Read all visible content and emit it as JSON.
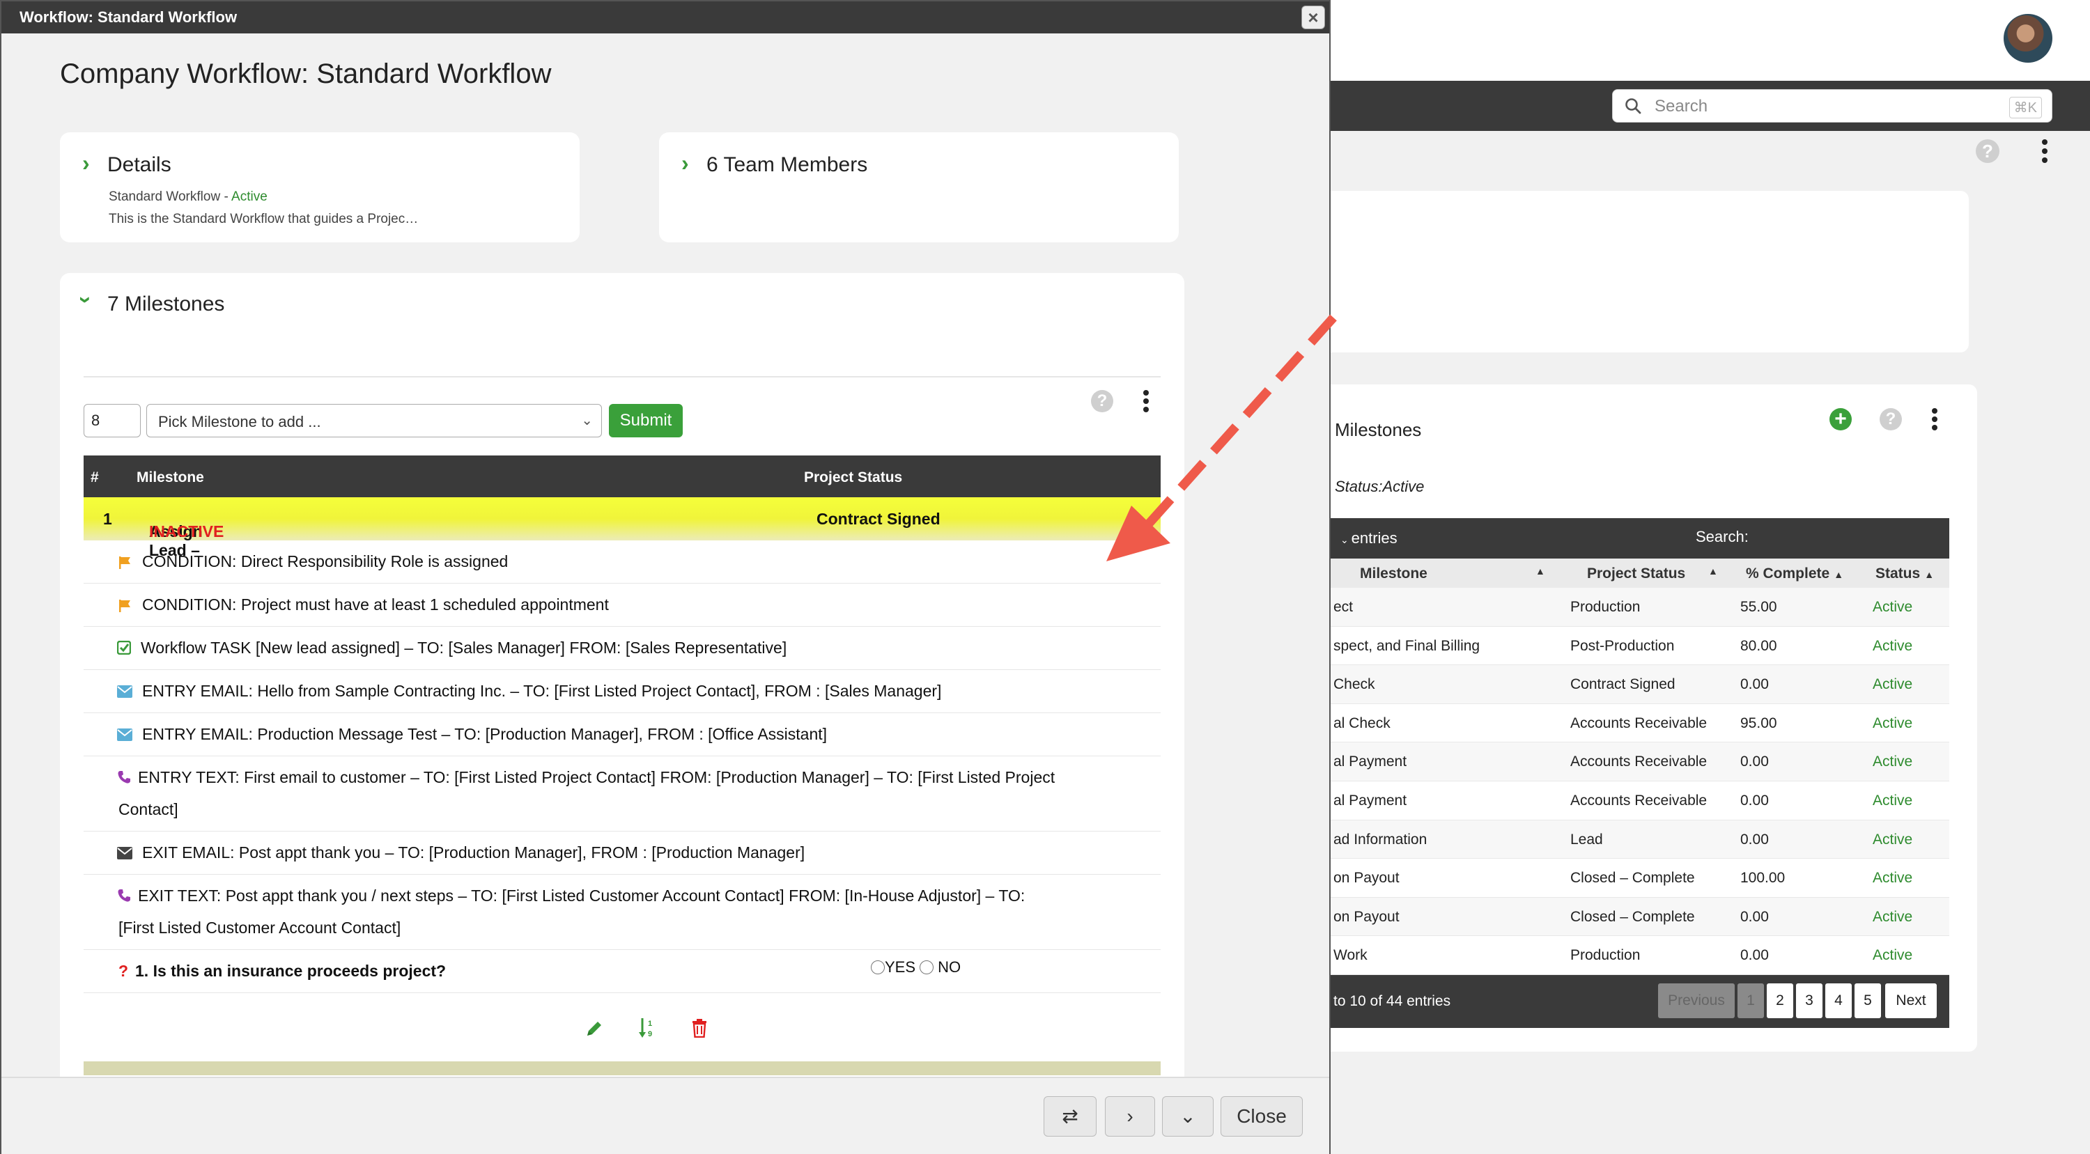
{
  "modal": {
    "titlebar": "Workflow: Standard Workflow",
    "close_x": "×",
    "page_title": "Company Workflow: Standard Workflow",
    "details": {
      "heading": "Details",
      "subtitle_prefix": "Standard Workflow - ",
      "status": "Active",
      "description": "This is the Standard Workflow that guides a Projec…"
    },
    "team": {
      "heading": "6 Team Members"
    },
    "milestones": {
      "heading": "7 Milestones",
      "step_value": "8",
      "pick_placeholder": "Pick Milestone to add ...",
      "submit_label": "Submit",
      "table_headers": {
        "num": "#",
        "milestone": "Milestone",
        "status": "Project Status"
      },
      "row1": {
        "num": "1",
        "name": "Assign Lead – ",
        "flag": "INACTIVE",
        "status": "Contract Signed"
      },
      "items": [
        {
          "icon": "flag-icon",
          "text": "CONDITION: Direct Responsibility Role is assigned"
        },
        {
          "icon": "flag-icon",
          "text": "CONDITION: Project must have at least 1 scheduled appointment"
        },
        {
          "icon": "task-check-icon",
          "text": "Workflow TASK [New lead assigned] – TO: [Sales Manager] FROM: [Sales Representative]"
        },
        {
          "icon": "envelope-icon",
          "text": "ENTRY EMAIL: Hello from Sample Contracting Inc. – TO: [First Listed Project Contact], FROM : [Sales Manager]"
        },
        {
          "icon": "envelope-icon",
          "text": "ENTRY EMAIL: Production Message Test – TO: [Production Manager], FROM : [Office Assistant]"
        },
        {
          "icon": "phone-icon",
          "text_line1": "ENTRY TEXT: First email to customer – TO: [First Listed Project Contact] FROM: [Production Manager] – TO: [First Listed Project",
          "text_line2": "Contact]"
        },
        {
          "icon": "envelope-dark-icon",
          "text": "EXIT EMAIL: Post appt thank you – TO: [Production Manager], FROM : [Production Manager]"
        },
        {
          "icon": "phone-icon",
          "text_line1": "EXIT TEXT: Post appt thank you / next steps – TO: [First Listed Customer Account Contact] FROM: [In-House Adjustor] – TO:",
          "text_line2": "[First Listed Customer Account Contact]"
        }
      ],
      "question": {
        "mark": "?",
        "text": "1. Is this an insurance proceeds project?",
        "yes": "YES",
        "no": "NO"
      }
    },
    "footer": {
      "close_label": "Close"
    }
  },
  "background": {
    "search_placeholder": "Search",
    "search_shortcut": "⌘K",
    "milestones_title": "Milestones",
    "status_filter": "Status:Active",
    "entries_label": "entries",
    "search_label": "Search:",
    "headers": {
      "milestone": "Milestone",
      "status": "Project Status",
      "complete": "% Complete",
      "active": "Status"
    },
    "rows": [
      {
        "milestone": "ect",
        "status": "Production",
        "complete": "55.00",
        "active": "Active"
      },
      {
        "milestone": "spect, and Final Billing",
        "status": "Post-Production",
        "complete": "80.00",
        "active": "Active"
      },
      {
        "milestone": "Check",
        "status": "Contract Signed",
        "complete": "0.00",
        "active": "Active"
      },
      {
        "milestone": "al Check",
        "status": "Accounts Receivable",
        "complete": "95.00",
        "active": "Active"
      },
      {
        "milestone": "al Payment",
        "status": "Accounts Receivable",
        "complete": "0.00",
        "active": "Active"
      },
      {
        "milestone": "al Payment",
        "status": "Accounts Receivable",
        "complete": "0.00",
        "active": "Active"
      },
      {
        "milestone": "ad Information",
        "status": "Lead",
        "complete": "0.00",
        "active": "Active"
      },
      {
        "milestone": "on Payout",
        "status": "Closed – Complete",
        "complete": "100.00",
        "active": "Active"
      },
      {
        "milestone": "on Payout",
        "status": "Closed – Complete",
        "complete": "0.00",
        "active": "Active"
      },
      {
        "milestone": "Work",
        "status": "Production",
        "complete": "0.00",
        "active": "Active"
      }
    ],
    "footer_info": "to 10 of 44 entries",
    "pagination": {
      "prev": "Previous",
      "pages": [
        "1",
        "2",
        "3",
        "4",
        "5"
      ],
      "next": "Next"
    }
  },
  "colors": {
    "accent_green": "#3aa03a",
    "inactive_red": "#e02020",
    "arrow_red": "#ef5a4a",
    "highlight_yellow": "#f5ff3a"
  }
}
